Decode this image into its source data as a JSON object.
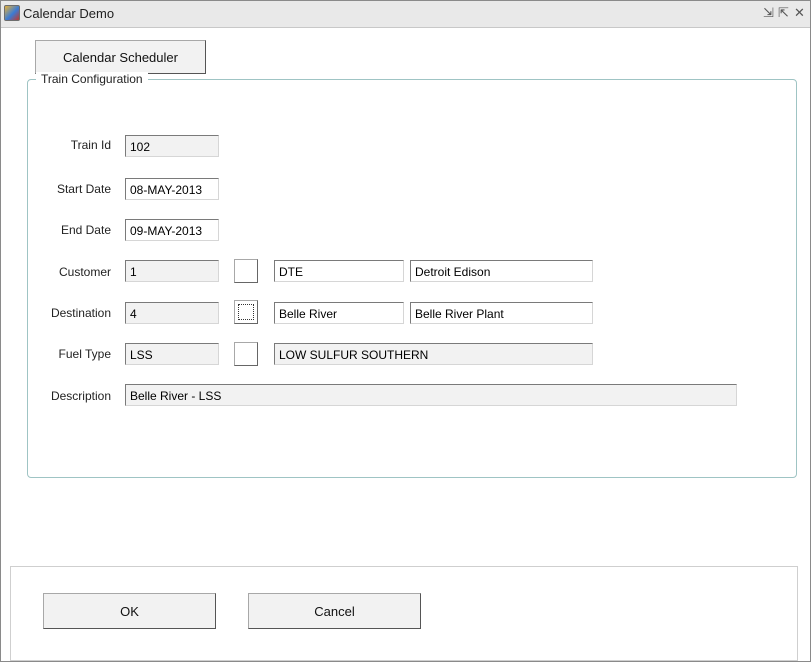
{
  "window": {
    "title": "Calendar Demo",
    "controls": [
      "⇲",
      "⇱",
      "✕"
    ]
  },
  "calendar_button": "Calendar Scheduler",
  "group": {
    "legend": "Train Configuration",
    "train_id": {
      "label": "Train Id",
      "value": "102"
    },
    "start_date": {
      "label": "Start Date",
      "value": "08-MAY-2013"
    },
    "end_date": {
      "label": "End Date",
      "value": "09-MAY-2013"
    },
    "customer": {
      "label": "Customer",
      "value": "1",
      "code": "DTE",
      "name": "Detroit Edison"
    },
    "destination": {
      "label": "Destination",
      "value": "4",
      "code": "Belle River",
      "name": "Belle River Plant"
    },
    "fuel_type": {
      "label": "Fuel Type",
      "value": "LSS",
      "name": "LOW SULFUR SOUTHERN"
    },
    "description": {
      "label": "Description",
      "value": "Belle River - LSS"
    }
  },
  "buttons": {
    "ok": "OK",
    "cancel": "Cancel"
  }
}
